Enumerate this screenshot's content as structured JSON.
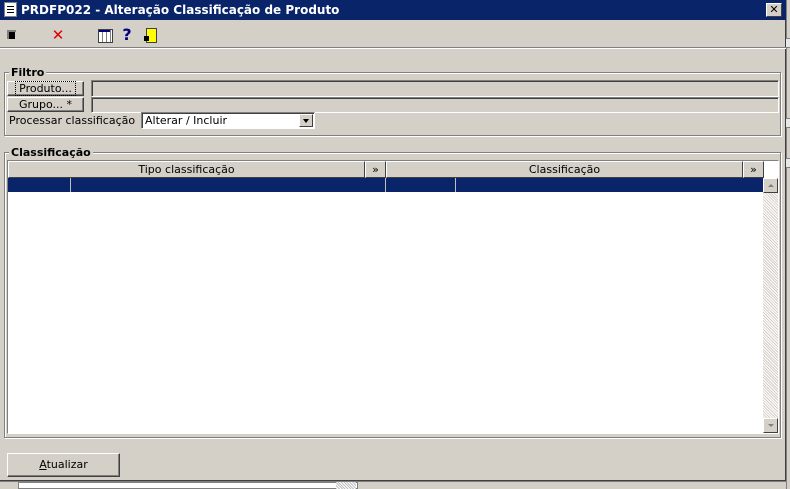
{
  "window": {
    "title": "PRDFP022 - Alteração Classificação de Produto",
    "close_glyph": "✕"
  },
  "toolbar": {
    "cancel_glyph": "✕",
    "help_glyph": "?"
  },
  "filtro": {
    "title": "Filtro",
    "produto_button": "Produto...",
    "produto_value": "",
    "grupo_button": "Grupo... *",
    "grupo_value": "",
    "processar_label": "Processar classificação",
    "processar_selected": "Alterar / Incluir"
  },
  "classificacao": {
    "title": "Classificação",
    "columns": [
      {
        "label": "Tipo classificação",
        "expand": "»"
      },
      {
        "label": "Classificação",
        "expand": "»"
      }
    ]
  },
  "footer": {
    "atualizar_prefix": "A",
    "atualizar_rest": "tualizar"
  }
}
